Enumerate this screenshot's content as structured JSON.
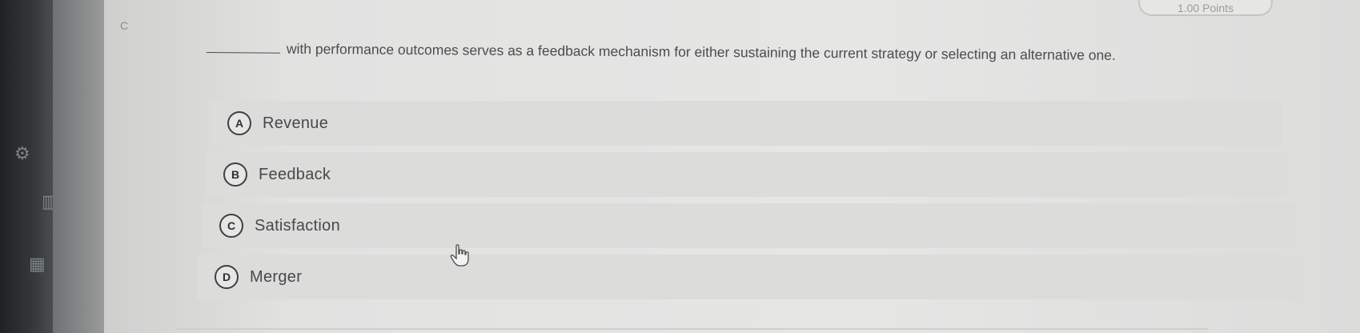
{
  "header": {
    "side_mark": "C",
    "points_label": "1.00 Points"
  },
  "question": {
    "text": "with performance outcomes serves as a feedback mechanism for either sustaining the current strategy or selecting an alternative one."
  },
  "options": [
    {
      "letter": "A",
      "label": "Revenue"
    },
    {
      "letter": "B",
      "label": "Feedback"
    },
    {
      "letter": "C",
      "label": "Satisfaction"
    },
    {
      "letter": "D",
      "label": "Merger"
    }
  ]
}
